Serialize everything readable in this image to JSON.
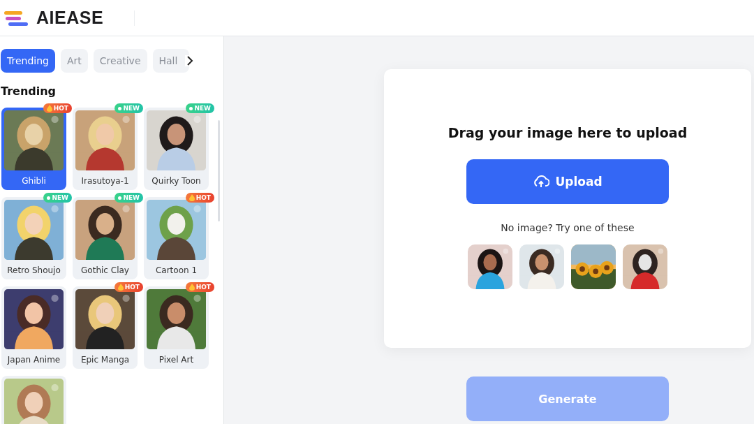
{
  "header": {
    "brand": "AIEASE"
  },
  "sidebar": {
    "tabs": [
      {
        "label": "Trending",
        "selected": true
      },
      {
        "label": "Art",
        "selected": false
      },
      {
        "label": "Creative",
        "selected": false
      },
      {
        "label": "Hall",
        "selected": false
      }
    ],
    "section_title": "Trending",
    "styles": [
      {
        "label": "Ghibli",
        "selected": true,
        "badge": {
          "kind": "hot",
          "text": "HOT"
        }
      },
      {
        "label": "Irasutoya-1",
        "selected": false,
        "badge": {
          "kind": "new",
          "text": "NEW"
        }
      },
      {
        "label": "Quirky Toon",
        "selected": false,
        "badge": {
          "kind": "new",
          "text": "NEW"
        }
      },
      {
        "label": "Retro Shoujo",
        "selected": false,
        "badge": {
          "kind": "new",
          "text": "NEW"
        }
      },
      {
        "label": "Gothic Clay",
        "selected": false,
        "badge": {
          "kind": "new",
          "text": "NEW"
        }
      },
      {
        "label": "Cartoon 1",
        "selected": false,
        "badge": {
          "kind": "hot",
          "text": "HOT"
        }
      },
      {
        "label": "Japan Anime",
        "selected": false
      },
      {
        "label": "Epic Manga",
        "selected": false,
        "badge": {
          "kind": "hot",
          "text": "HOT"
        }
      },
      {
        "label": "Pixel Art",
        "selected": false,
        "badge": {
          "kind": "hot",
          "text": "HOT"
        }
      },
      {
        "selected": false
      }
    ]
  },
  "upload": {
    "title": "Drag your image here to upload",
    "button": "Upload",
    "hint": "No image? Try one of these"
  },
  "generate_button": {
    "label": "Generate",
    "disabled": true
  }
}
